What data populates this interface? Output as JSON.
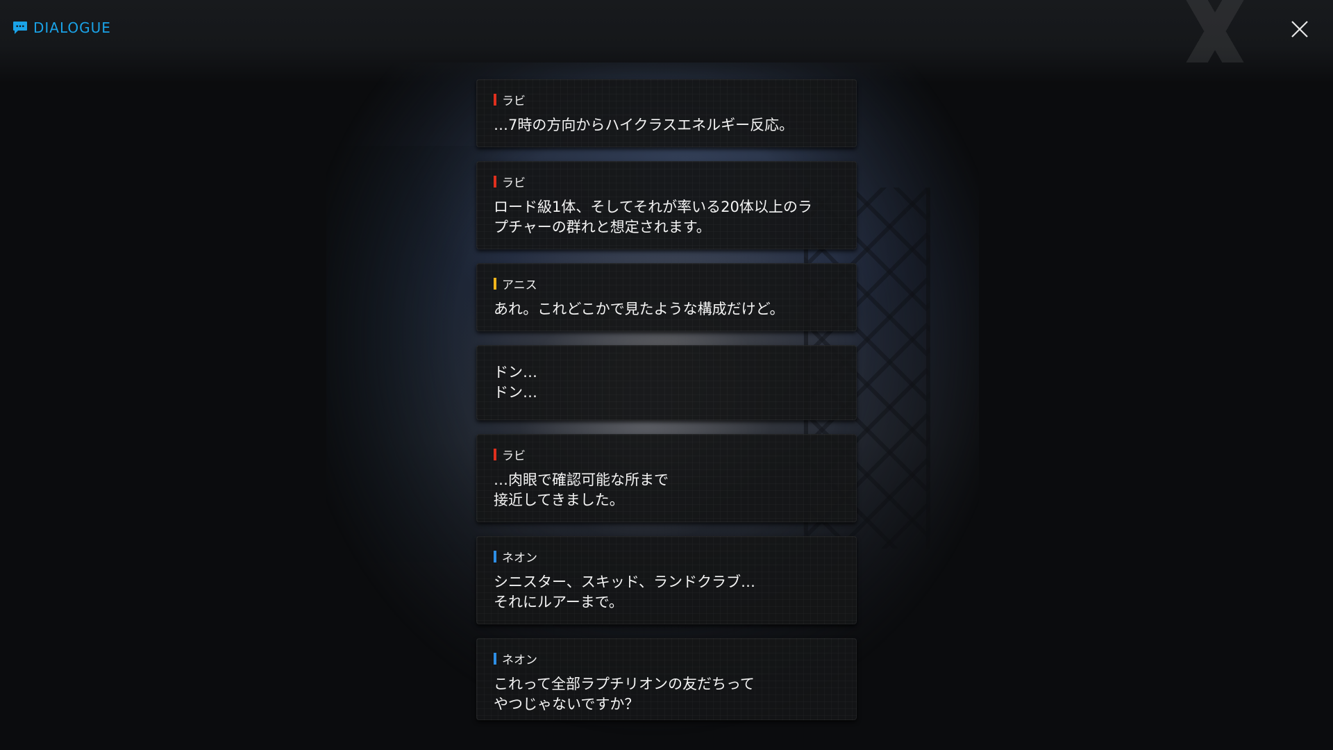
{
  "header": {
    "title": "DIALOGUE",
    "title_icon": "chat-bubble-icon",
    "close_icon": "close-icon",
    "accent_color": "#1aa3e8"
  },
  "dialogue": [
    {
      "speaker": "ラビ",
      "speaker_color": "#e0301e",
      "lines": [
        "…7時の方向からハイクラスエネルギー反応。"
      ]
    },
    {
      "speaker": "ラビ",
      "speaker_color": "#e0301e",
      "lines": [
        "ロード級1体、そしてそれが率いる20体以上のラ",
        "プチャーの群れと想定されます。"
      ]
    },
    {
      "speaker": "アニス",
      "speaker_color": "#f0b41c",
      "lines": [
        "あれ。これどこかで見たような構成だけど。"
      ]
    },
    {
      "speaker": "",
      "speaker_color": "",
      "lines": [
        "ドン…",
        "ドン…"
      ]
    },
    {
      "speaker": "ラビ",
      "speaker_color": "#e0301e",
      "lines": [
        "…肉眼で確認可能な所まで",
        "接近してきました。"
      ]
    },
    {
      "speaker": "ネオン",
      "speaker_color": "#2e8fe6",
      "lines": [
        "シニスター、スキッド、ランドクラブ…",
        "それにルアーまで。"
      ]
    },
    {
      "speaker": "ネオン",
      "speaker_color": "#2e8fe6",
      "lines": [
        "これって全部ラプチリオンの友だちって",
        "やつじゃないですか？"
      ]
    }
  ]
}
